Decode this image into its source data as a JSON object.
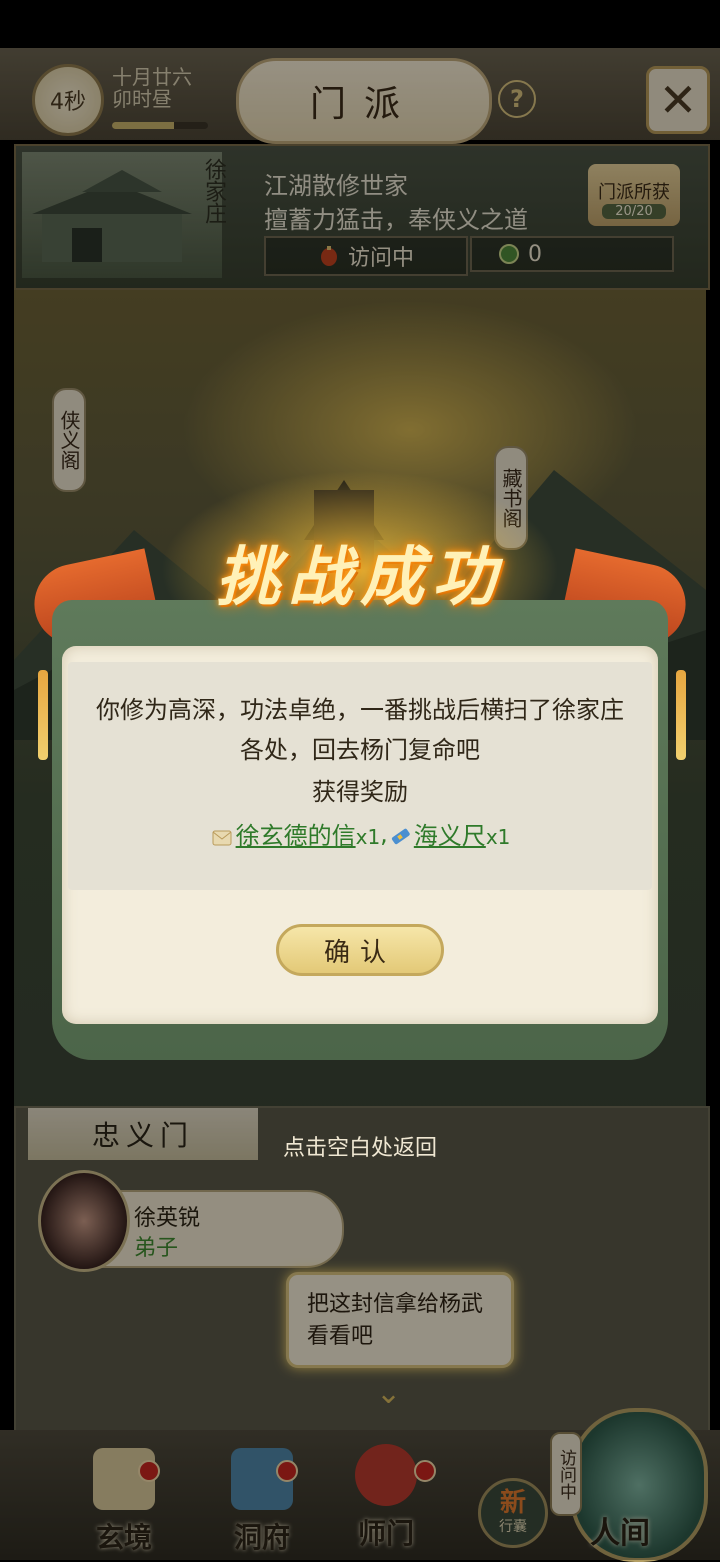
{
  "header": {
    "timer": "4秒",
    "date_line1": "十月廿六",
    "date_line2": "卯时昼",
    "time_progress": 0.65,
    "title": "门派",
    "help_label": "?",
    "close_label": "✕"
  },
  "sect": {
    "name": "徐家庄",
    "desc_line1": "江湖散修世家",
    "desc_line2": "擅蓄力猛击，奉侠义之道",
    "status": "访问中",
    "count": "0",
    "gain_label": "门派所获",
    "gain_value": "20/20"
  },
  "scene": {
    "pavilion_left": "侠义阁",
    "pavilion_right": "藏书阁"
  },
  "lower": {
    "section_label": "忠义门",
    "member_name": "徐英锐",
    "member_role": "弟子",
    "speech": "把这封信拿给杨武看看吧",
    "chevron": "⌄"
  },
  "nav": {
    "items": [
      {
        "label": "玄境",
        "color": "#d9c89a"
      },
      {
        "label": "洞府",
        "color": "#4f86a8"
      },
      {
        "label": "师门",
        "color": "#b83a2e"
      }
    ],
    "bag_new": "新",
    "bag_label": "行囊",
    "world_tag": "访问中",
    "world_label": "人间"
  },
  "modal": {
    "headline": "挑战成功",
    "message": "你修为高深，功法卓绝，一番挑战后横扫了徐家庄各处，回去杨门复命吧",
    "reward_title": "获得奖励",
    "rewards": [
      {
        "name": "徐玄德的信",
        "qty": "x1",
        "icon": "letter-icon"
      },
      {
        "name": "海义尺",
        "qty": "x1",
        "icon": "ruler-icon"
      }
    ],
    "separator": ",",
    "confirm_label": "确认",
    "back_hint": "点击空白处返回"
  },
  "colors": {
    "accent_gold": "#e3c977",
    "reward_green": "#2f7a2a",
    "ribbon_orange": "#e56a2e",
    "scroll_green": "#5f7a5b"
  }
}
